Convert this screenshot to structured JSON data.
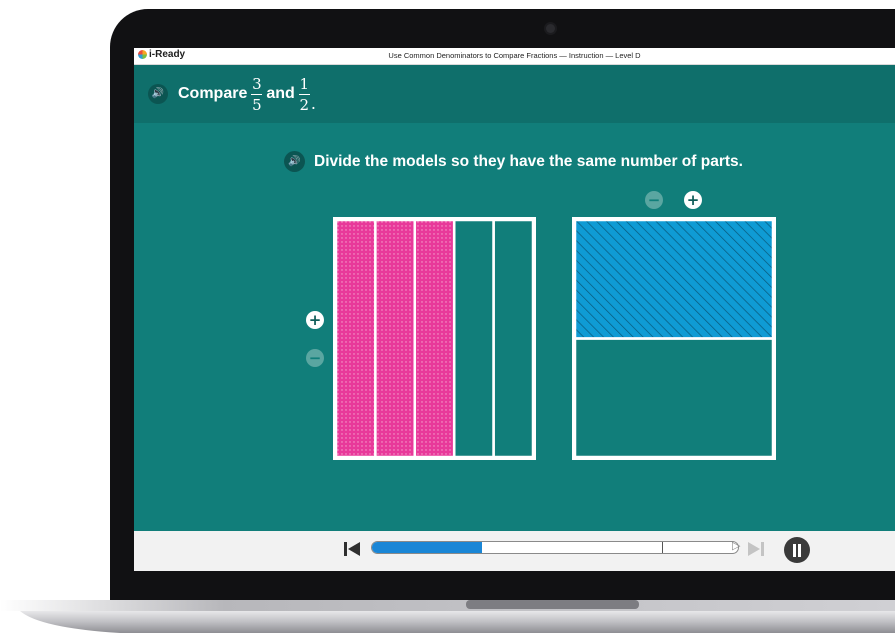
{
  "app": {
    "logo_text": "i-Ready",
    "lesson_title": "Use Common Denominators to Compare Fractions — Instruction — Level D"
  },
  "header": {
    "compare_text": "Compare",
    "and_text": "and",
    "fraction_a": {
      "numerator": "3",
      "denominator": "5"
    },
    "fraction_b": {
      "numerator": "1",
      "denominator": "2"
    },
    "period": "."
  },
  "instruction": {
    "text": "Divide the models so they have the same number of parts."
  },
  "controls": {
    "minus_glyph": "−",
    "plus_glyph": "+"
  },
  "models": {
    "left": {
      "parts": 5,
      "shaded": 3,
      "orientation": "vertical",
      "fill_color": "#e8399a",
      "pattern": "dots"
    },
    "right": {
      "parts": 2,
      "shaded": 1,
      "orientation": "horizontal",
      "fill_color": "#0f9bd4",
      "pattern": "hatch"
    }
  },
  "player": {
    "progress_fraction": 0.3,
    "colors": {
      "progress": "#1a86d6",
      "background_teal": "#117e7a",
      "header_teal": "#0f6f6b"
    }
  }
}
